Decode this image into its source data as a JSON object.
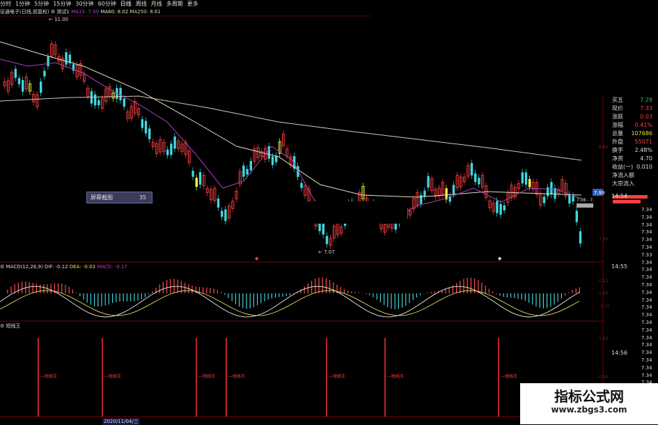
{
  "tabs": [
    "分时",
    "1分钟",
    "5分钟",
    "15分钟",
    "30分钟",
    "60分钟",
    "日线",
    "周线",
    "月线",
    "多周期",
    "更多"
  ],
  "info": {
    "stock": "证通电子(日线,前复权)",
    "indicator": "测试1",
    "ma15": "MA15: 7.09",
    "ma60": "MA60: 8.02",
    "ma250": "MA250: 8.61"
  },
  "price_marks": {
    "high": "11.00",
    "low": "7.07",
    "right_tag": "7.99",
    "last_label": "7.08 - 7."
  },
  "tooltip": {
    "label": "屏幕截图",
    "value": "35"
  },
  "side_panel": [
    {
      "label": "买五",
      "value": "7.29",
      "color": "#3fbf3f"
    },
    {
      "label": "现价",
      "value": "7.33",
      "color": "#ff4040"
    },
    {
      "label": "涨跌",
      "value": "0.03",
      "color": "#ff4040"
    },
    {
      "label": "涨幅",
      "value": "0.41%",
      "color": "#ff4040"
    },
    {
      "label": "总量",
      "value": "107686",
      "color": "#e6e600"
    },
    {
      "label": "外盘",
      "value": "55071",
      "color": "#ff4040"
    },
    {
      "label": "换手",
      "value": "2.48%",
      "color": "#dddddd"
    },
    {
      "label": "净资",
      "value": "4.70",
      "color": "#dddddd"
    },
    {
      "label": "收益(一)",
      "value": "0.010",
      "color": "#dddddd"
    },
    {
      "label": "净流入额",
      "value": "",
      "color": "#ff4040"
    },
    {
      "label": "大宗流入",
      "value": "",
      "color": "#ff4040"
    }
  ],
  "times": [
    "14:54",
    "14:55",
    "14:56"
  ],
  "price_col": [
    "7.34",
    "7.34",
    "7.34",
    "7.34",
    "7.34",
    "7.34",
    "7.33",
    "7.34",
    "7.34",
    "7.34",
    "7.34",
    "7.34",
    "7.34",
    "7.34",
    "7.34",
    "7.34",
    "7.34",
    "7.34",
    "7.34",
    "7.34",
    "7.34",
    "7.34",
    "7.34",
    "7.34",
    "7.34",
    "7.34",
    "7.34",
    "7.34",
    "7.34"
  ],
  "macd": {
    "label": "MACD(12,26,9)",
    "dif": "DIF: -0.12",
    "dea": "DEA: -0.03",
    "macd": "MACD: -0.17"
  },
  "signal": {
    "label": "短线王",
    "mark": "短线王"
  },
  "axis_dates": [
    "2020/11/04/三"
  ],
  "watermark": {
    "title": "指标公式网",
    "url": "www.zbgs3.com"
  },
  "colors": {
    "up": "#ff4040",
    "down": "#3fd8e0",
    "ma15": "#b040c0",
    "ma60": "#e0e0c0",
    "ma250": "#d9c9b0",
    "yellow": "#ffff40"
  }
}
